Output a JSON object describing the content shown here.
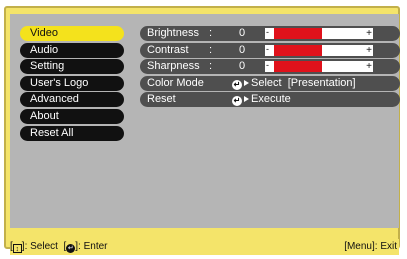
{
  "menu": {
    "items": [
      {
        "label": "Video",
        "selected": true
      },
      {
        "label": "Audio",
        "selected": false
      },
      {
        "label": "Setting",
        "selected": false
      },
      {
        "label": "User's Logo",
        "selected": false
      },
      {
        "label": "Advanced",
        "selected": false
      },
      {
        "label": "About",
        "selected": false
      },
      {
        "label": "Reset All",
        "selected": false
      }
    ]
  },
  "settings": {
    "brightness": {
      "label": "Brightness",
      "colon": ":",
      "value": "0",
      "minus": "-",
      "plus": "+"
    },
    "contrast": {
      "label": "Contrast",
      "colon": ":",
      "value": "0",
      "minus": "-",
      "plus": "+"
    },
    "sharpness": {
      "label": "Sharpness",
      "colon": ":",
      "value": "0",
      "minus": "-",
      "plus": "+"
    },
    "color_mode": {
      "label": "Color Mode",
      "action": "Select",
      "current": "[Presentation]"
    },
    "reset": {
      "label": "Reset",
      "action": "Execute"
    }
  },
  "status": {
    "select_hint": ": Select",
    "enter_hint": ": Enter",
    "exit_hint": "[Menu]: Exit"
  },
  "levels": {
    "brightness": 0.5,
    "contrast": 0.5,
    "sharpness": 0.5
  },
  "colors": {
    "frame": "#f4e46a",
    "panel": "#b5b5b5",
    "selected_item": "#f4e21c",
    "menu_item": "#111111",
    "row": "#4f4f4f",
    "bar_fill": "#e0121b"
  },
  "icons": {
    "enter": "enter-icon",
    "arrow": "right-arrow-icon",
    "updown": "updown-icon"
  }
}
